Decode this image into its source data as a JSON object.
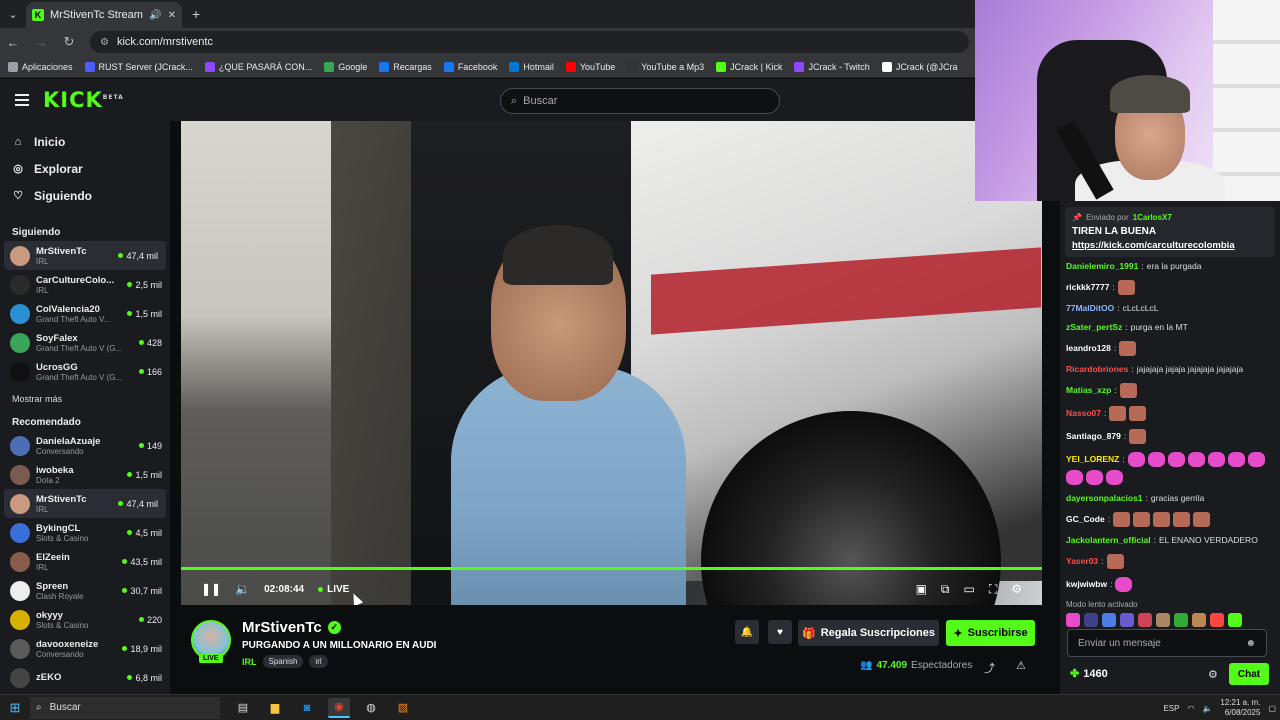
{
  "browser": {
    "tab_title": "MrStivenTc Stream - Watch",
    "url": "kick.com/mrstiventc",
    "bookmarks": [
      {
        "label": "Aplicaciones",
        "color": "#9aa0a6"
      },
      {
        "label": "RUST Server (JCrack...",
        "color": "#4c5cff"
      },
      {
        "label": "¿QUE PASARÁ CON...",
        "color": "#9146ff"
      },
      {
        "label": "Google",
        "color": "#34a853"
      },
      {
        "label": "Recargas",
        "color": "#1877f2"
      },
      {
        "label": "Facebook",
        "color": "#1877f2"
      },
      {
        "label": "Hotmail",
        "color": "#0078d4"
      },
      {
        "label": "YouTube",
        "color": "#ff0000"
      },
      {
        "label": "YouTube a Mp3",
        "color": "#333333"
      },
      {
        "label": "JCrack | Kick",
        "color": "#53fc18"
      },
      {
        "label": "JCrack - Twitch",
        "color": "#9146ff"
      },
      {
        "label": "JCrack (@JCra",
        "color": "#ffffff"
      }
    ]
  },
  "header": {
    "logo": "KICK",
    "logo_beta": "BETA",
    "search_placeholder": "Buscar"
  },
  "sidebar": {
    "nav": [
      {
        "label": "Inicio",
        "icon": "home-icon"
      },
      {
        "label": "Explorar",
        "icon": "compass-icon"
      },
      {
        "label": "Siguiendo",
        "icon": "heart-icon"
      }
    ],
    "following_title": "Siguiendo",
    "following": [
      {
        "name": "MrStivenTc",
        "category": "IRL",
        "viewers": "47,4 mil",
        "color": "#c99a80"
      },
      {
        "name": "CarCultureColo...",
        "category": "IRL",
        "viewers": "2,5 mil",
        "color": "#2a2a2a"
      },
      {
        "name": "ColValencia20",
        "category": "Grand Theft Auto V...",
        "viewers": "1,5 mil",
        "color": "#2b8fd6"
      },
      {
        "name": "SoyFalex",
        "category": "Grand Theft Auto V (G...",
        "viewers": "428",
        "color": "#3aa55a"
      },
      {
        "name": "UcrosGG",
        "category": "Grand Theft Auto V (G...",
        "viewers": "166",
        "color": "#111111"
      }
    ],
    "show_more": "Mostrar más",
    "recommended_title": "Recomendado",
    "recommended": [
      {
        "name": "DanielaAzuaje",
        "category": "Conversando",
        "viewers": "149",
        "color": "#4a6fb5"
      },
      {
        "name": "iwobeka",
        "category": "Dota 2",
        "viewers": "1,5 mil",
        "color": "#7a5c4e"
      },
      {
        "name": "MrStivenTc",
        "category": "IRL",
        "viewers": "47,4 mil",
        "color": "#c99a80"
      },
      {
        "name": "BykingCL",
        "category": "Slots & Casino",
        "viewers": "4,5 mil",
        "color": "#3b6fd8"
      },
      {
        "name": "ElZeein",
        "category": "IRL",
        "viewers": "43,5 mil",
        "color": "#8a5a4a"
      },
      {
        "name": "Spreen",
        "category": "Clash Royale",
        "viewers": "30,7 mil",
        "color": "#eeeeee"
      },
      {
        "name": "okyyy",
        "category": "Slots & Casino",
        "viewers": "220",
        "color": "#d8b000"
      },
      {
        "name": "davooxeneize",
        "category": "Conversando",
        "viewers": "18,9 mil",
        "color": "#5a5a5a"
      },
      {
        "name": "zEKO",
        "category": "",
        "viewers": "6,8 mil",
        "color": "#444444"
      }
    ]
  },
  "player": {
    "time": "02:08:44",
    "live_label": "LIVE"
  },
  "stream": {
    "streamer": "MrStivenTc",
    "live_badge": "LIVE",
    "title": "PURGANDO A UN MILLONARIO EN AUDI",
    "category": "IRL",
    "tags": [
      "Spanish",
      "irl"
    ],
    "gift_label": "Regala Suscripciones",
    "subscribe_label": "Suscribirse",
    "viewers_count": "47.409",
    "viewers_label": "Espectadores"
  },
  "chat": {
    "pinned_by_label": "Enviado por",
    "pinned_by_user": "1CarlosX7",
    "pinned_message": "TIREN LA BUENA",
    "pinned_link": "https://kick.com/carculturecolombia",
    "messages": [
      {
        "user": "Danielemiro_1991",
        "color": "#53fc18",
        "text": "era la purgada",
        "emotes": 0
      },
      {
        "user": "rickkk7777",
        "color": "#ffffff",
        "text": "",
        "emotes": 1
      },
      {
        "user": "77MalDitOO",
        "color": "#8ab4ff",
        "text": "cLcLcLcL",
        "emotes": 0
      },
      {
        "user": "zSater_pertSz",
        "color": "#53fc18",
        "text": "purga en la MT",
        "emotes": 0
      },
      {
        "user": "leandro128",
        "color": "#ffffff",
        "text": "",
        "emotes": 1
      },
      {
        "user": "Ricardobriones",
        "color": "#ff4d4d",
        "text": "jajajaja jajaja jajajaja jajajaja",
        "emotes": 0
      },
      {
        "user": "Matias_xzp",
        "color": "#53fc18",
        "text": "",
        "emotes": 1
      },
      {
        "user": "Nasso07",
        "color": "#ff4d4d",
        "text": "",
        "emotes": 2
      },
      {
        "user": "Santiago_879",
        "color": "#ffffff",
        "text": "",
        "emotes": 1
      },
      {
        "user": "YEI_LORENZ",
        "color": "#ffea00",
        "text": "",
        "emotes": 10,
        "pink": true
      },
      {
        "user": "dayersonpalacios1",
        "color": "#53fc18",
        "text": "gracias gerrila",
        "emotes": 0
      },
      {
        "user": "GC_Code",
        "color": "#ffffff",
        "text": "",
        "emotes": 5
      },
      {
        "user": "Jackolantern_official",
        "color": "#53fc18",
        "text": "EL ENANO VERDADERO",
        "emotes": 0
      },
      {
        "user": "Yaser03",
        "color": "#ff4d4d",
        "text": "",
        "emotes": 1
      },
      {
        "user": "kwjwiwbw",
        "color": "#ffffff",
        "text": "",
        "emotes": 1,
        "pink": true
      }
    ],
    "slow_mode": "Modo lento activado",
    "input_placeholder": "Enviar un mensaje",
    "points": "1460",
    "chat_button": "Chat"
  },
  "taskbar": {
    "search": "Buscar",
    "language": "ESP",
    "time": "12:21 a. m.",
    "date": "6/08/2025"
  }
}
